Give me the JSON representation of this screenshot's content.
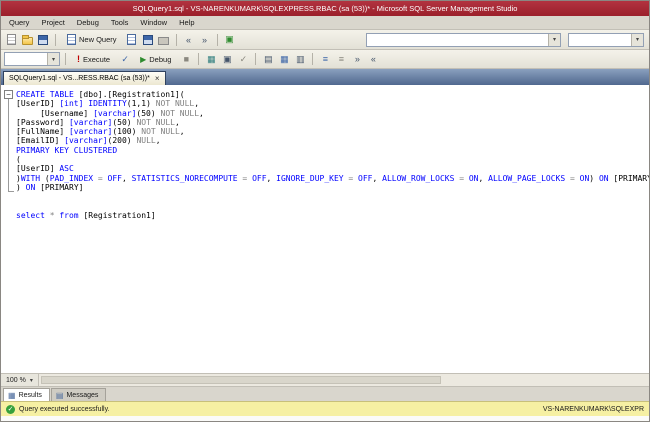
{
  "window": {
    "title": "SQLQuery1.sql - VS-NARENKUMARK\\SQLEXPRESS.RBAC (sa (53))* - Microsoft SQL Server Management Studio"
  },
  "colors": {
    "titlebar": "#9b1f2b",
    "tab_strip": "#50688f",
    "status_bar": "#f6f0a3",
    "success_green": "#36a03c",
    "keyword": "#0000ff",
    "operator": "#808080",
    "text": "#000000"
  },
  "menu": {
    "items": [
      "Query",
      "Project",
      "Debug",
      "Tools",
      "Window",
      "Help"
    ]
  },
  "toolbar_standard": {
    "new_query_label": "New Query"
  },
  "toolbar_sql": {
    "execute_label": "Execute",
    "debug_label": "Debug"
  },
  "icons": {
    "execute_bang": "!",
    "debug_play": "▶",
    "parse_check": "✓",
    "stop": "■",
    "plan": "▦",
    "options": "▣",
    "intellisense": "✓",
    "results_text": "▤",
    "results_grid": "▦",
    "results_file": "▥",
    "comment": "≡",
    "uncomment": "≡",
    "indent": "»",
    "outdent": "«",
    "undo": "«",
    "redo": "»",
    "activity": "▣",
    "dropdown": "▾",
    "tab_close": "×",
    "status_check": "✓",
    "collapse": "−",
    "messages_doc": "▤"
  },
  "doc_tab": {
    "label": "SQLQuery1.sql - VS...RESS.RBAC (sa (53))*"
  },
  "editor": {
    "lines": [
      [
        {
          "t": "CREATE TABLE",
          "c": "kw"
        },
        {
          "t": " [dbo].[Registration1](",
          "c": "pl"
        }
      ],
      [
        {
          "t": "[UserID] ",
          "c": "pl"
        },
        {
          "t": "[int] IDENTITY",
          "c": "kw"
        },
        {
          "t": "(1,1) ",
          "c": "pl"
        },
        {
          "t": "NOT NULL",
          "c": "gr"
        },
        {
          "t": ",",
          "c": "pl"
        }
      ],
      [
        {
          "t": "     [Username] ",
          "c": "pl"
        },
        {
          "t": "[varchar]",
          "c": "kw"
        },
        {
          "t": "(50) ",
          "c": "pl"
        },
        {
          "t": "NOT NULL",
          "c": "gr"
        },
        {
          "t": ",",
          "c": "pl"
        }
      ],
      [
        {
          "t": "[Password] ",
          "c": "pl"
        },
        {
          "t": "[varchar]",
          "c": "kw"
        },
        {
          "t": "(50) ",
          "c": "pl"
        },
        {
          "t": "NOT NULL",
          "c": "gr"
        },
        {
          "t": ",",
          "c": "pl"
        }
      ],
      [
        {
          "t": "[FullName] ",
          "c": "pl"
        },
        {
          "t": "[varchar]",
          "c": "kw"
        },
        {
          "t": "(100) ",
          "c": "pl"
        },
        {
          "t": "NOT NULL",
          "c": "gr"
        },
        {
          "t": ",",
          "c": "pl"
        }
      ],
      [
        {
          "t": "[EmailID] ",
          "c": "pl"
        },
        {
          "t": "[varchar]",
          "c": "kw"
        },
        {
          "t": "(200) ",
          "c": "pl"
        },
        {
          "t": "NULL",
          "c": "gr"
        },
        {
          "t": ",",
          "c": "pl"
        }
      ],
      [
        {
          "t": "PRIMARY KEY CLUSTERED",
          "c": "kw"
        }
      ],
      [
        {
          "t": "(",
          "c": "pl"
        }
      ],
      [
        {
          "t": "[UserID] ",
          "c": "pl"
        },
        {
          "t": "ASC",
          "c": "kw"
        }
      ],
      [
        {
          "t": ")",
          "c": "pl"
        },
        {
          "t": "WITH",
          "c": "kw"
        },
        {
          "t": " (",
          "c": "pl"
        },
        {
          "t": "PAD_INDEX ",
          "c": "kw"
        },
        {
          "t": "= ",
          "c": "gr"
        },
        {
          "t": "OFF",
          "c": "kw"
        },
        {
          "t": ", ",
          "c": "pl"
        },
        {
          "t": "STATISTICS_NORECOMPUTE ",
          "c": "kw"
        },
        {
          "t": "= ",
          "c": "gr"
        },
        {
          "t": "OFF",
          "c": "kw"
        },
        {
          "t": ", ",
          "c": "pl"
        },
        {
          "t": "IGNORE_DUP_KEY ",
          "c": "kw"
        },
        {
          "t": "= ",
          "c": "gr"
        },
        {
          "t": "OFF",
          "c": "kw"
        },
        {
          "t": ", ",
          "c": "pl"
        },
        {
          "t": "ALLOW_ROW_LOCKS ",
          "c": "kw"
        },
        {
          "t": "= ",
          "c": "gr"
        },
        {
          "t": "ON",
          "c": "kw"
        },
        {
          "t": ", ",
          "c": "pl"
        },
        {
          "t": "ALLOW_PAGE_LOCKS ",
          "c": "kw"
        },
        {
          "t": "= ",
          "c": "gr"
        },
        {
          "t": "ON",
          "c": "kw"
        },
        {
          "t": ") ",
          "c": "pl"
        },
        {
          "t": "ON",
          "c": "kw"
        },
        {
          "t": " [PRIMARY]",
          "c": "pl"
        }
      ],
      [
        {
          "t": ") ",
          "c": "pl"
        },
        {
          "t": "ON",
          "c": "kw"
        },
        {
          "t": " [PRIMARY]",
          "c": "pl"
        }
      ],
      [],
      [],
      [
        {
          "t": "select",
          "c": "kw"
        },
        {
          "t": " * ",
          "c": "gr"
        },
        {
          "t": "from",
          "c": "kw"
        },
        {
          "t": " [Registration1]",
          "c": "pl"
        }
      ]
    ]
  },
  "zoom": {
    "label": "100 %"
  },
  "results_pane": {
    "tabs": [
      {
        "label": "Results"
      },
      {
        "label": "Messages"
      }
    ]
  },
  "status_bar": {
    "message": "Query executed successfully.",
    "server": "VS-NARENKUMARK\\SQLEXPR"
  }
}
